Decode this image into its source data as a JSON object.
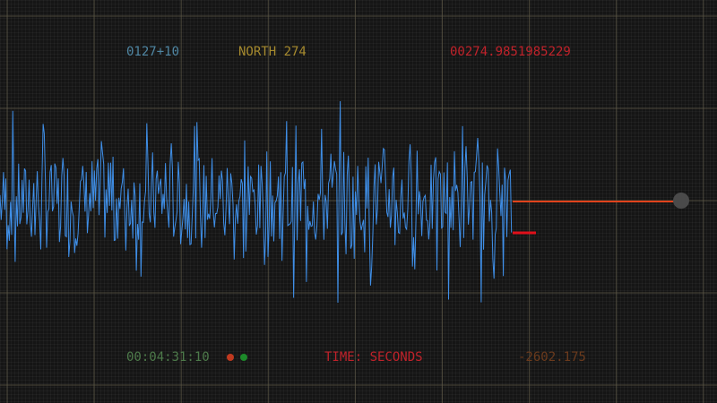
{
  "readouts": {
    "station": "0127+10",
    "heading": "NORTH 274",
    "value": "00274.9851985229",
    "timecode": "00:04:31:10",
    "axis_label": "TIME: SECONDS",
    "offset": "-2602.175"
  },
  "indicators": [
    {
      "name": "red",
      "color": "#c0391f"
    },
    {
      "name": "green",
      "color": "#1d8a2a"
    }
  ],
  "colors": {
    "station": "#4f86a3",
    "heading": "#a68a2e",
    "value": "#c0222a",
    "timecode": "#4d7a4a",
    "axis_label": "#c0222a",
    "offset": "#6b3a1c",
    "waveform": "#3f8fe8",
    "trace": "#e0431c",
    "marker": "#e0101a",
    "grid": "#5f5a48"
  }
}
